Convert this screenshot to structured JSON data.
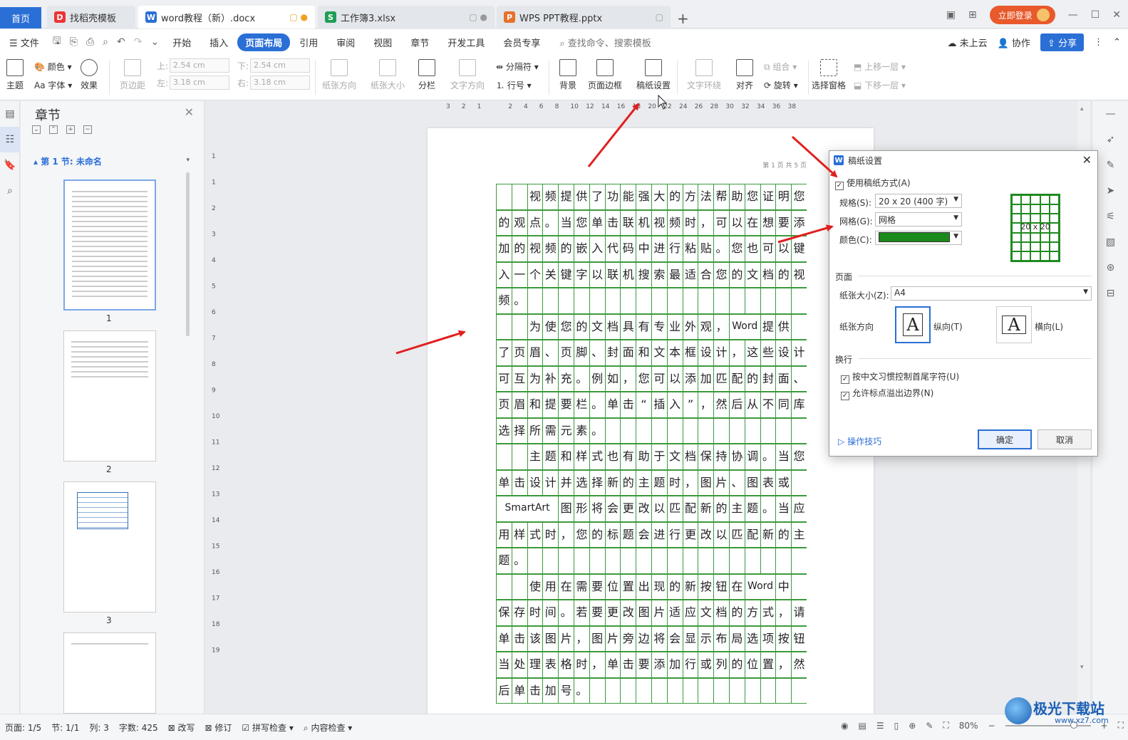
{
  "tabs": {
    "home": "首页",
    "items": [
      {
        "label": "找稻壳模板",
        "icon": "docer-icon"
      },
      {
        "label": "word教程（新）.docx",
        "icon": "word-icon"
      },
      {
        "label": "工作簿3.xlsx",
        "icon": "excel-icon"
      },
      {
        "label": "WPS PPT教程.pptx",
        "icon": "ppt-icon"
      }
    ],
    "login": "立即登录"
  },
  "menubar": {
    "file": "文件",
    "items": [
      "开始",
      "插入",
      "页面布局",
      "引用",
      "审阅",
      "视图",
      "章节",
      "开发工具",
      "会员专享"
    ],
    "active": "页面布局",
    "search": "查找命令、搜索模板",
    "cloud": "未上云",
    "collab": "协作",
    "share": "分享"
  },
  "ribbon": {
    "theme": "主题",
    "color": "颜色",
    "font": "Aa 字体",
    "effect": "效果",
    "margin": "页边距",
    "margin_top_label": "上:",
    "margin_top": "2.54 cm",
    "margin_bottom_label": "下:",
    "margin_bottom": "2.54 cm",
    "margin_left_label": "左:",
    "margin_left": "3.18 cm",
    "margin_right_label": "右:",
    "margin_right": "3.18 cm",
    "orientation": "纸张方向",
    "size": "纸张大小",
    "columns": "分栏",
    "text_direction": "文字方向",
    "breaks": "分隔符",
    "line_numbers": "行号",
    "background": "背景",
    "page_border": "页面边框",
    "manuscript": "稿纸设置",
    "wrap": "文字环绕",
    "align": "对齐",
    "group": "组合",
    "rotate": "旋转",
    "selection_pane": "选择窗格",
    "bring_forward": "上移一层",
    "send_backward": "下移一层"
  },
  "chapter_panel": {
    "title": "章节",
    "section": "第 1 节: 未命名",
    "pages": [
      "1",
      "2",
      "3"
    ]
  },
  "ruler": {
    "h_ticks": [
      "3",
      "2",
      "1",
      "",
      "2",
      "4",
      "6",
      "8",
      "10",
      "12",
      "14",
      "16",
      "18",
      "20",
      "22",
      "24",
      "26",
      "28",
      "30",
      "32",
      "34",
      "36",
      "38"
    ],
    "v_ticks": [
      "1",
      "1",
      "2",
      "3",
      "4",
      "5",
      "6",
      "7",
      "8",
      "9",
      "10",
      "11",
      "12",
      "13",
      "14",
      "15",
      "16",
      "17",
      "18",
      "19"
    ]
  },
  "document": {
    "page_header": "第 1 页 共 5 页",
    "lines": [
      "  视频提供了功能强大的方法帮助您证明您",
      "的观点。当您单击联机视频时，可以在想要添",
      "加的视频的嵌入代码中进行粘贴。您也可以键",
      "入一个关键字以联机搜索最适合您的文档的视",
      "频。",
      "  为使您的文档具有专业外观，Word 提供",
      "了页眉、页脚、封面和文本框设计，这些设计",
      "可互为补充。例如，您可以添加匹配的封面、",
      "页眉和提要栏。单击“插入”，然后从不同库中",
      "选择所需元素。",
      "  主题和样式也有助于文档保持协调。当您",
      "单击设计并选择新的主题时，图片、图表或",
      "SmartArt 图形将会更改以匹配新的主题。当应",
      "用样式时，您的标题会进行更改以匹配新的主",
      "题。",
      "  使用在需要位置出现的新按钮在 Word 中",
      "保存时间。若要更改图片适应文档的方式，请",
      "单击该图片，图片旁边将会显示布局选项按钮。",
      "当处理表格时，单击要添加行或列的位置，然",
      "后单击加号。"
    ]
  },
  "dialog": {
    "title": "稿纸设置",
    "use_manuscript": "使用稿纸方式(A)",
    "spec_label": "规格(S):",
    "spec_value": "20 x 20 (400 字)",
    "grid_label": "网格(G):",
    "grid_value": "网格",
    "color_label": "颜色(C):",
    "color_value": "#1a8a1a",
    "preview_label": "20 x 20",
    "page_section": "页面",
    "paper_size_label": "纸张大小(Z):",
    "paper_size_value": "A4",
    "orientation_label": "纸张方向",
    "portrait": "纵向(T)",
    "landscape": "横向(L)",
    "wrap_section": "换行",
    "wrap_opt1": "按中文习惯控制首尾字符(U)",
    "wrap_opt2": "允许标点溢出边界(N)",
    "tips": "操作技巧",
    "ok": "确定",
    "cancel": "取消"
  },
  "statusbar": {
    "page": "页面: 1/5",
    "section": "节: 1/1",
    "column": "列: 3",
    "words": "字数: 425",
    "rewrite": "改写",
    "track": "修订",
    "spell": "拼写检查",
    "content_check": "内容检查",
    "zoom": "80%",
    "zoom_level": 0.8
  },
  "watermark": {
    "name": "极光下载站",
    "url": "www.xz7.com"
  },
  "colors": {
    "accent": "#2a6fd6",
    "grid_green": "#3c9a3c",
    "arrow_red": "#e02020"
  }
}
